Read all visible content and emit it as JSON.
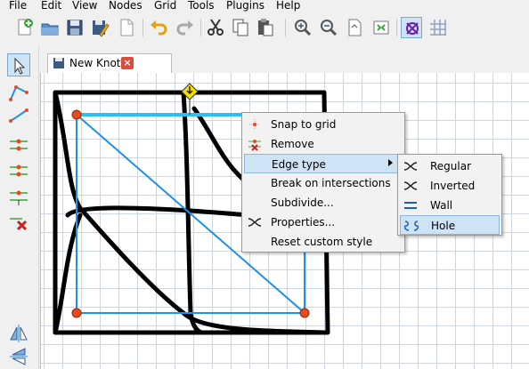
{
  "menubar": [
    "File",
    "Edit",
    "View",
    "Nodes",
    "Grid",
    "Tools",
    "Plugins",
    "Help"
  ],
  "toolbar": {
    "buttons": [
      "new-icon",
      "open-icon",
      "save-icon",
      "save-as-icon",
      "export-icon",
      "undo-icon",
      "redo-icon",
      "cut-icon",
      "copy-icon",
      "paste-icon",
      "zoom-in-icon",
      "zoom-out-icon",
      "fit-page-icon",
      "zoom-reset-icon",
      "knot-display-icon",
      "grid-icon"
    ]
  },
  "left_tools": [
    "select-icon",
    "edge-chain-icon",
    "edge-icon",
    "edge-type-regular-icon",
    "edge-type-inverted-icon",
    "edge-type-wall-icon",
    "delete-edge-icon",
    "mirror-horizontal-icon",
    "mirror-vertical-icon"
  ],
  "tab": {
    "label": "New Knot",
    "close": "×"
  },
  "context_menu": {
    "items": [
      {
        "label": "Snap to grid",
        "icon": "snap-grid-icon"
      },
      {
        "label": "Remove",
        "icon": "remove-node-icon"
      },
      {
        "label": "Edge type",
        "icon": "",
        "submenu": true
      },
      {
        "label": "Break on intersections",
        "icon": ""
      },
      {
        "label": "Subdivide...",
        "icon": ""
      },
      {
        "label": "Properties...",
        "icon": "properties-icon"
      },
      {
        "label": "Reset custom style",
        "icon": ""
      }
    ]
  },
  "edge_type_submenu": {
    "items": [
      {
        "label": "Regular",
        "icon": "regular-edge-icon"
      },
      {
        "label": "Inverted",
        "icon": "inverted-edge-icon"
      },
      {
        "label": "Wall",
        "icon": "wall-edge-icon"
      },
      {
        "label": "Hole",
        "icon": "hole-edge-icon"
      }
    ]
  },
  "colors": {
    "edge": "#1e90e8",
    "selected_edge": "#2ac0f0",
    "node": "#e84a1e",
    "knot": "#000000",
    "highlight": "#cfe3f7"
  }
}
